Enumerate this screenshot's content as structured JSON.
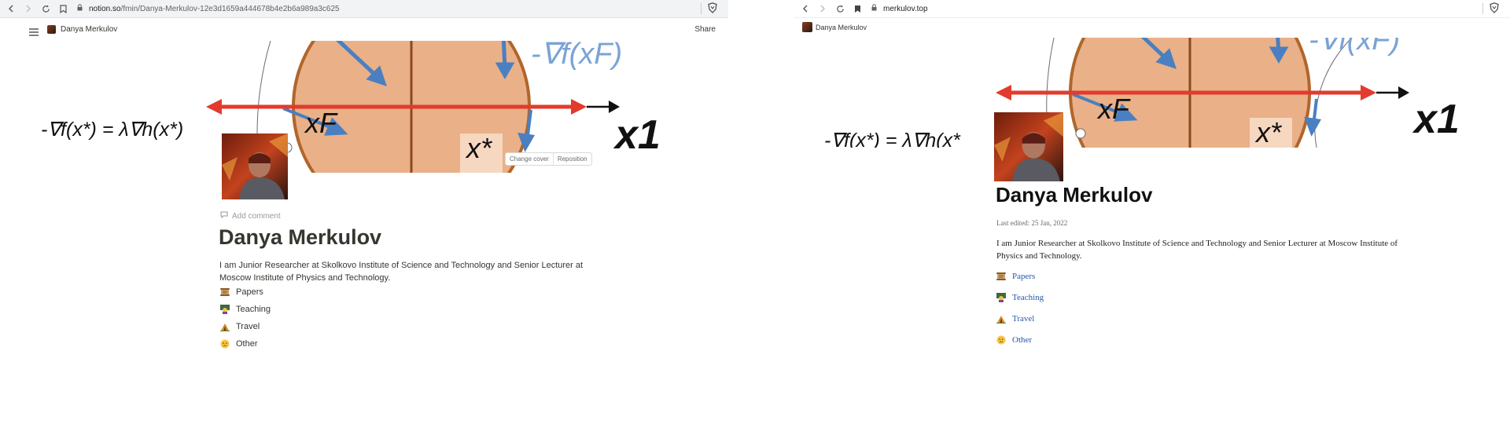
{
  "left_window": {
    "browser": {
      "url_host": "notion.so",
      "url_path": "/fmin/Danya-Merkulov-12e3d1659a444678b4e2b6a989a3c625"
    },
    "topbar": {
      "breadcrumb": "Danya Merkulov",
      "share_label": "Share"
    },
    "cover": {
      "formula_left": "-∇f(x*) =  λ∇h(x*)",
      "label_xf": "xF",
      "label_xstar": "x*",
      "label_grad": "-∇f(xF)",
      "label_x1": "x1",
      "change_cover": "Change cover",
      "reposition": "Reposition"
    },
    "add_comment": "Add comment",
    "title": "Danya Merkulov",
    "description": "I am Junior Researcher at Skolkovo Institute of Science and Technology and Senior Lecturer at Moscow Institute of Physics and Technology.",
    "links": [
      {
        "label": "Papers",
        "icon": "scroll-icon"
      },
      {
        "label": "Teaching",
        "icon": "teacher-icon"
      },
      {
        "label": "Travel",
        "icon": "camping-icon"
      },
      {
        "label": "Other",
        "icon": "thinking-face-icon"
      }
    ]
  },
  "right_window": {
    "browser": {
      "url_host": "merkulov.top"
    },
    "topbar": {
      "breadcrumb": "Danya Merkulov"
    },
    "cover": {
      "formula_left": "-∇f(x*) =  λ∇h(x*",
      "label_xf": "xF",
      "label_xstar": "x*",
      "label_grad": "-∇f(xF)",
      "label_x1": "x1"
    },
    "title": "Danya Merkulov",
    "last_edited": "Last edited: 25 Jan, 2022",
    "description": "I am Junior Researcher at Skolkovo Institute of Science and Technology and Senior Lecturer at Moscow Institute of Physics and Technology.",
    "links": [
      {
        "label": "Papers",
        "icon": "scroll-icon"
      },
      {
        "label": "Teaching",
        "icon": "teacher-icon"
      },
      {
        "label": "Travel",
        "icon": "camping-icon"
      },
      {
        "label": "Other",
        "icon": "thinking-face-icon"
      }
    ]
  },
  "colors": {
    "orange_fill": "#eab088",
    "orange_border": "#b0662b",
    "arrow_blue": "#4a7fc1",
    "arrow_red": "#e23b2e",
    "link_blue": "#2458a8"
  }
}
